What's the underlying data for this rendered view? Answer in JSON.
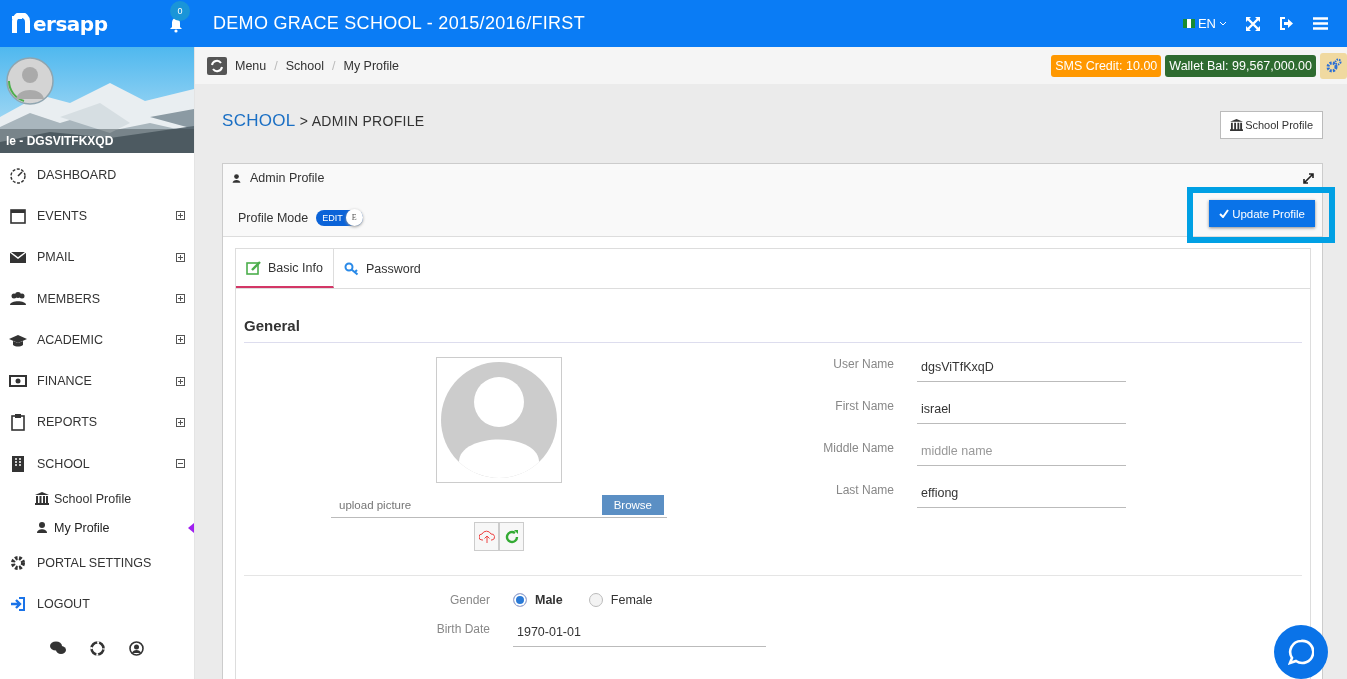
{
  "topbar": {
    "logo": "ersapp",
    "notifications": "0",
    "title": "DEMO GRACE SCHOOL - 2015/2016/FIRST",
    "language": "EN"
  },
  "user": {
    "name": "le - DGSVITFKXQD"
  },
  "sidebar": {
    "items": [
      {
        "label": "DASHBOARD"
      },
      {
        "label": "EVENTS",
        "expanded": false
      },
      {
        "label": "PMAIL",
        "expanded": false
      },
      {
        "label": "MEMBERS",
        "expanded": false
      },
      {
        "label": "ACADEMIC",
        "expanded": false
      },
      {
        "label": "FINANCE",
        "expanded": false
      },
      {
        "label": "REPORTS",
        "expanded": false
      },
      {
        "label": "SCHOOL",
        "expanded": true,
        "children": [
          {
            "label": "School Profile",
            "selected": false
          },
          {
            "label": "My Profile",
            "selected": true
          }
        ]
      },
      {
        "label": "PORTAL SETTINGS"
      },
      {
        "label": "LOGOUT"
      }
    ]
  },
  "breadcrumb": {
    "separator": "/",
    "items": [
      "Menu",
      "School",
      "My Profile"
    ]
  },
  "badges": [
    {
      "text": "SMS Credit: 10.00",
      "color": "#ff9800"
    },
    {
      "text": "Wallet Bal: 99,567,000.00",
      "color": "#2e6b30"
    }
  ],
  "page_title": {
    "section": "SCHOOL",
    "separator": ">",
    "title": "ADMIN PROFILE"
  },
  "school_profile_button": "School Profile",
  "panel": {
    "title": "Admin Profile",
    "mode_label": "Profile Mode",
    "mode_switch": {
      "label": "EDIT",
      "knob": "E",
      "on": true
    },
    "update_button": {
      "label": "Update Profile",
      "highlighted": true
    },
    "tabs": [
      {
        "label": "Basic Info",
        "selected": true
      },
      {
        "label": "Password",
        "selected": false
      }
    ],
    "section": "General",
    "upload": {
      "placeholder": "upload picture",
      "browse": "Browse"
    },
    "fields": [
      {
        "label": "User Name",
        "value": "dgsViTfKxqD"
      },
      {
        "label": "First Name",
        "value": "israel"
      },
      {
        "label": "Middle Name",
        "placeholder": "middle name"
      },
      {
        "label": "Last Name",
        "value": "effiong"
      }
    ],
    "gender": {
      "label": "Gender",
      "options": [
        {
          "label": "Male",
          "selected": true
        },
        {
          "label": "Female",
          "selected": false
        }
      ]
    },
    "birth_date": {
      "label": "Birth Date",
      "value": "1970-01-01"
    }
  }
}
